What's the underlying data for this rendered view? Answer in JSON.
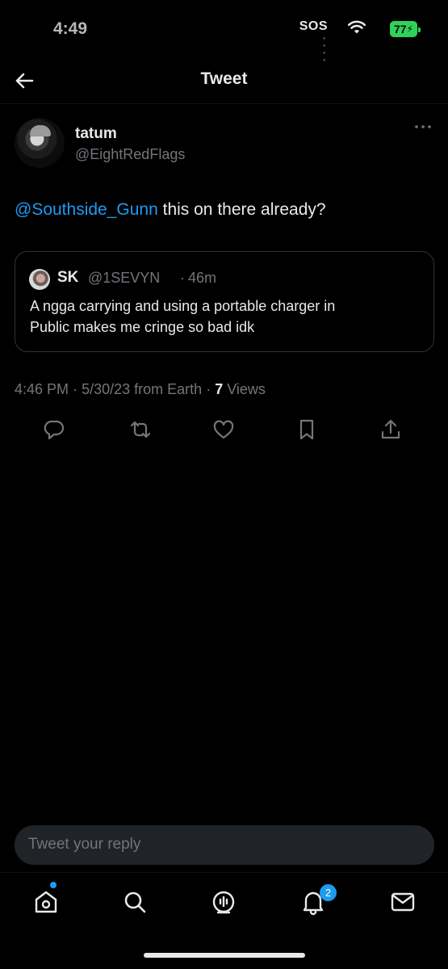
{
  "status_bar": {
    "time": "4:49",
    "carrier": "SOS",
    "battery": "77"
  },
  "header": {
    "title": "Tweet"
  },
  "tweet": {
    "author_name": "tatum",
    "author_handle": "@EightRedFlags",
    "mention": "@Southside_Gunn",
    "text": " this on there already?",
    "time": "4:46 PM",
    "date": "5/30/23",
    "source": "from Earth",
    "views_count": "7",
    "views_label": "Views"
  },
  "quoted_tweet": {
    "author_name": "SK",
    "author_handle": "@1SEVYN",
    "time_ago": "46m",
    "text": "A ngga carrying and using a portable charger  in\nPublic makes me cringe so bad idk"
  },
  "reply": {
    "placeholder": "Tweet your reply"
  },
  "tab_bar": {
    "notifications_badge": "2"
  },
  "colors": {
    "background": "#000000",
    "accent": "#1d9bf0",
    "text_primary": "#e7e9ea",
    "text_secondary": "#71767b",
    "battery": "#30d158"
  },
  "icons": {
    "back": "arrow-left-icon",
    "more": "more-horizontal-icon",
    "reply": "reply-icon",
    "retweet": "retweet-icon",
    "like": "heart-icon",
    "bookmark": "bookmark-icon",
    "share": "share-icon",
    "home": "home-icon",
    "search": "search-icon",
    "spaces": "spaces-icon",
    "notifications": "bell-icon",
    "messages": "mail-icon"
  }
}
